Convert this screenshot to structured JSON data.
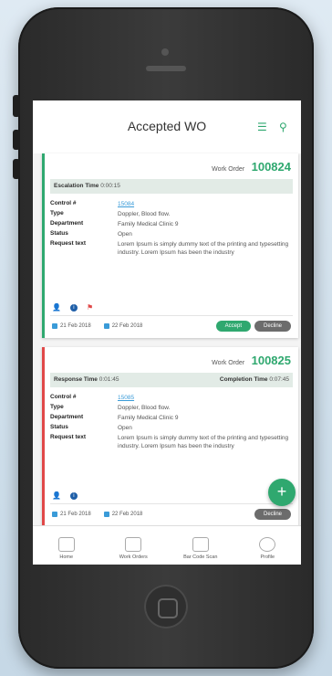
{
  "header": {
    "title": "Accepted WO"
  },
  "cards": [
    {
      "wo_label": "Work Order",
      "wo_number": "100824",
      "band_left_label": "Escalation Time",
      "band_left_value": "0:00:15",
      "fields": [
        {
          "k": "Control #",
          "v": "15084"
        },
        {
          "k": "Type",
          "v": "Doppler, Blood flow."
        },
        {
          "k": "Department",
          "v": "Family Medical Clinic 9"
        },
        {
          "k": "Status",
          "v": "Open"
        },
        {
          "k": "Request text",
          "v": "Lorem Ipsum is simply dummy text of the printing and typesetting industry. Lorem Ipsum has been the industry"
        }
      ],
      "date1": "21 Feb 2018",
      "date2": "22 Feb 2018",
      "accept": "Accept",
      "decline": "Decline"
    },
    {
      "wo_label": "Work Order",
      "wo_number": "100825",
      "band_left_label": "Response Time",
      "band_left_value": "0:01:45",
      "band_right_label": "Completion Time",
      "band_right_value": "0:07:45",
      "fields": [
        {
          "k": "Control #",
          "v": "15085"
        },
        {
          "k": "Type",
          "v": "Doppler, Blood flow."
        },
        {
          "k": "Department",
          "v": "Family Medical Clinic 9"
        },
        {
          "k": "Status",
          "v": "Open"
        },
        {
          "k": "Request text",
          "v": "Lorem Ipsum is simply dummy text of the printing and typesetting industry. Lorem Ipsum has been the industry"
        }
      ],
      "date1": "21 Feb 2018",
      "date2": "22 Feb 2018",
      "decline": "Decline"
    }
  ],
  "fab": "+",
  "tabs": [
    {
      "label": "Home",
      "icon": "home-icon"
    },
    {
      "label": "Work Orders",
      "icon": "work-orders-icon"
    },
    {
      "label": "Bar Code Scan",
      "icon": "barcode-icon"
    },
    {
      "label": "Profile",
      "icon": "profile-icon"
    }
  ],
  "colors": {
    "accent": "#2fa86f",
    "alert": "#e04848",
    "link": "#3a9bd8"
  }
}
